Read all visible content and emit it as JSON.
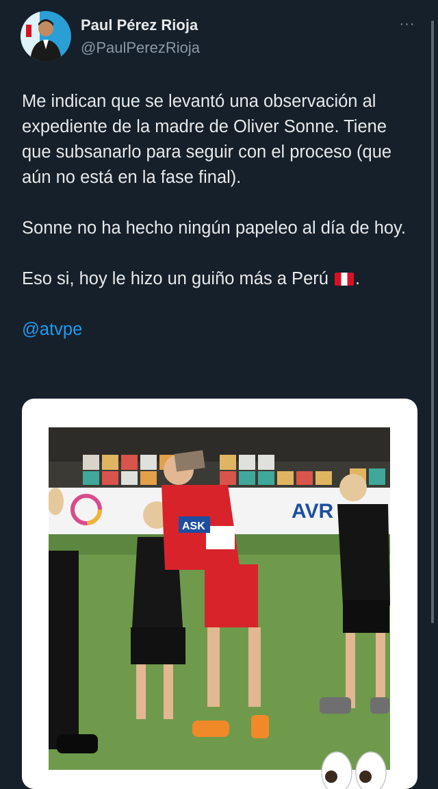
{
  "author": {
    "display_name": "Paul Pérez Rioja",
    "handle": "@PaulPerezRioja"
  },
  "more_icon": "more-horizontal-icon",
  "more_glyph": "···",
  "tweet": {
    "paragraph_1": "Me indican que se levantó una observación al expediente de la madre de Oliver Sonne. Tiene que subsanarlo para seguir con el proceso (que aún no está en la fase final).",
    "paragraph_2": "Sonne no ha hecho ningún papeleo al día de hoy.",
    "paragraph_3_text": "Eso si, hoy le hizo un guiño más a Perú",
    "paragraph_3_flag": "peru-flag-icon",
    "paragraph_3_end": ".",
    "mention": "@atvpe"
  },
  "media": {
    "photo_text_bib": "ASK",
    "banner_text": "AVR"
  },
  "colors": {
    "background": "#15202b",
    "text": "#e7e9ea",
    "secondary": "#8b98a5",
    "link": "#1d9bf0"
  }
}
